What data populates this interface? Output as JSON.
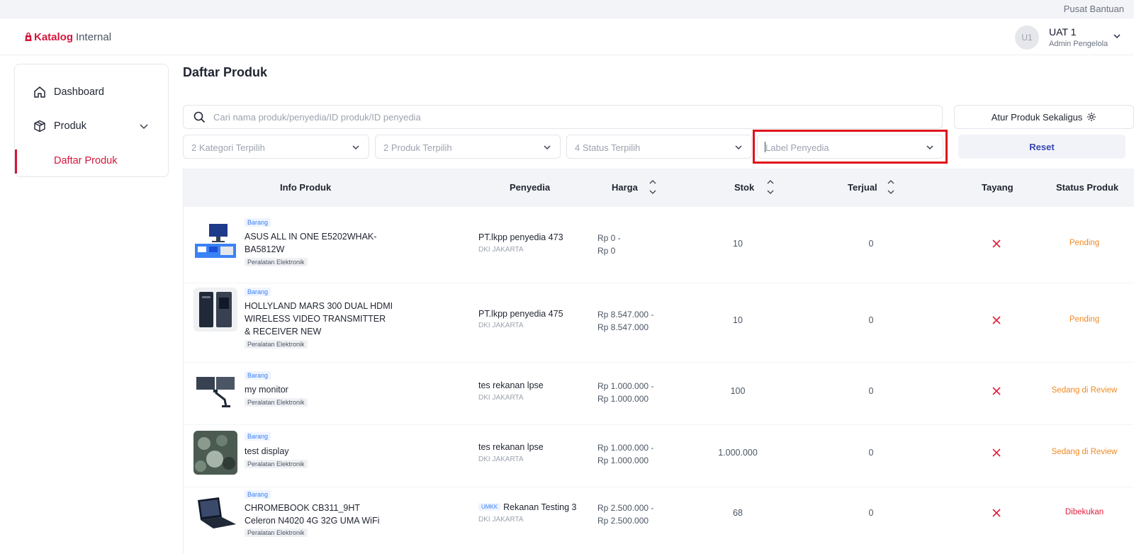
{
  "topbar": {
    "help_link": "Pusat Bantuan"
  },
  "header": {
    "logo_mark": "Katalog",
    "logo_sub": "Internal",
    "avatar_initials": "U1",
    "user_name": "UAT 1",
    "user_role": "Admin Pengelola"
  },
  "sidebar": {
    "items": [
      {
        "label": "Dashboard",
        "icon": "home-icon"
      },
      {
        "label": "Produk",
        "icon": "box-icon"
      }
    ],
    "sub_items": [
      {
        "label": "Daftar Produk",
        "active": true
      }
    ]
  },
  "page": {
    "title": "Daftar Produk"
  },
  "filters": {
    "search_placeholder": "Cari nama produk/penyedia/ID produk/ID penyedia",
    "bulk_button": "Atur Produk Sekaligus",
    "kategori": "2 Kategori Terpilih",
    "produk": "2 Produk Terpilih",
    "status": "4 Status Terpilih",
    "label_penyedia_placeholder": "Label Penyedia",
    "reset": "Reset"
  },
  "table": {
    "headers": {
      "info": "Info Produk",
      "penyedia": "Penyedia",
      "harga": "Harga",
      "stok": "Stok",
      "terjual": "Terjual",
      "tayang": "Tayang",
      "status": "Status Produk"
    },
    "rows": [
      {
        "type": "Barang",
        "name": "ASUS ALL IN ONE E5202WHAK-BA5812W",
        "category": "Peralatan Elektronik",
        "umkm": "",
        "vendor": "PT.lkpp penyedia 473",
        "region": "DKI JAKARTA",
        "price_min": "Rp 0 -",
        "price_max": "Rp 0",
        "stock": "10",
        "sold": "0",
        "tayang": "x",
        "status": "Pending"
      },
      {
        "type": "Barang",
        "name": "HOLLYLAND MARS 300 DUAL HDMI WIRELESS VIDEO TRANSMITTER & RECEIVER NEW",
        "category": "Peralatan Elektronik",
        "umkm": "",
        "vendor": "PT.lkpp penyedia 475",
        "region": "DKI JAKARTA",
        "price_min": "Rp 8.547.000 -",
        "price_max": "Rp 8.547.000",
        "stock": "10",
        "sold": "0",
        "tayang": "x",
        "status": "Pending"
      },
      {
        "type": "Barang",
        "name": "my monitor",
        "category": "Peralatan Elektronik",
        "umkm": "",
        "vendor": "tes rekanan lpse",
        "region": "DKI JAKARTA",
        "price_min": "Rp 1.000.000 -",
        "price_max": "Rp 1.000.000",
        "stock": "100",
        "sold": "0",
        "tayang": "x",
        "status": "Sedang di Review"
      },
      {
        "type": "Barang",
        "name": "test display",
        "category": "Peralatan Elektronik",
        "umkm": "",
        "vendor": "tes rekanan lpse",
        "region": "DKI JAKARTA",
        "price_min": "Rp 1.000.000 -",
        "price_max": "Rp 1.000.000",
        "stock": "1.000.000",
        "sold": "0",
        "tayang": "x",
        "status": "Sedang di Review"
      },
      {
        "type": "Barang",
        "name": "CHROMEBOOK CB311_9HT Celeron N4020 4G 32G UMA WiFi",
        "category": "Peralatan Elektronik",
        "umkm": "UMKK",
        "vendor": "Rekanan Testing 3",
        "region": "DKI JAKARTA",
        "price_min": "Rp 2.500.000 -",
        "price_max": "Rp 2.500.000",
        "stock": "68",
        "sold": "0",
        "tayang": "x",
        "status": "Dibekukan"
      }
    ]
  },
  "colors": {
    "brand": "#d6163b",
    "accent": "#3946b0",
    "pending": "#f08a24",
    "frozen": "#e11d3a",
    "highlight": "#e0101a"
  }
}
